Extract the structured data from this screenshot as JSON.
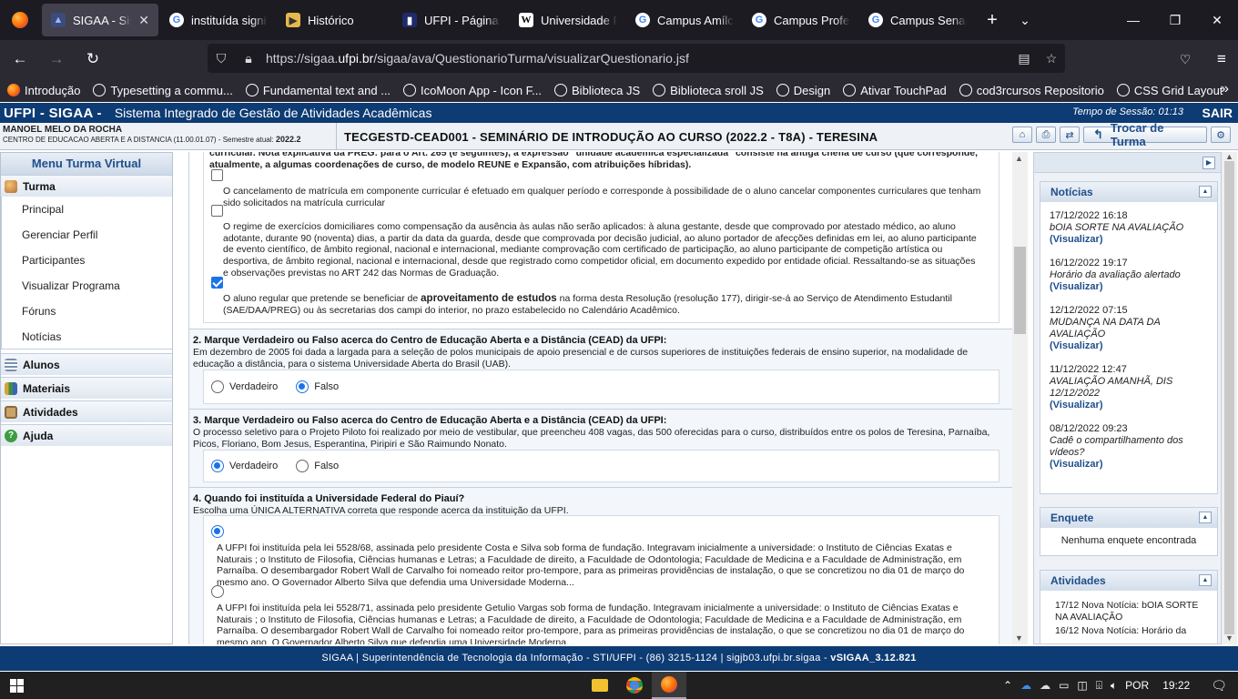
{
  "browser": {
    "tabs": [
      {
        "title": "SIGAA - Sistem",
        "active": true,
        "icon": "sigaa-favicon"
      },
      {
        "title": "instituída signific",
        "active": false,
        "icon": "google-favicon"
      },
      {
        "title": "Histórico",
        "active": false,
        "icon": "pdf-favicon"
      },
      {
        "title": "UFPI - Página inic",
        "active": false,
        "icon": "ufpi-favicon"
      },
      {
        "title": "Universidade Fed",
        "active": false,
        "icon": "wikipedia-favicon"
      },
      {
        "title": "Campus Amílcar",
        "active": false,
        "icon": "google-favicon"
      },
      {
        "title": "Campus Professo",
        "active": false,
        "icon": "google-favicon"
      },
      {
        "title": "Campus Senador",
        "active": false,
        "icon": "google-favicon"
      }
    ],
    "url_prefix": "https://sigaa.",
    "url_domain": "ufpi.br",
    "url_path": "/sigaa/ava/QuestionarioTurma/visualizarQuestionario.jsf",
    "bookmarks": [
      "Introdução",
      "Typesetting a commu...",
      "Fundamental text and ...",
      "IcoMoon App - Icon F...",
      "Biblioteca JS",
      "Biblioteca sroll JS",
      "Design",
      "Ativar TouchPad",
      "cod3rcursos Repositorio",
      "CSS Grid Layout"
    ]
  },
  "sigaa": {
    "brand": "UFPI - SIGAA -",
    "system": "Sistema Integrado de Gestão de Atividades Acadêmicas",
    "session_label": "Tempo de Sessão:",
    "session_time": "01:13",
    "logout": "SAIR",
    "user_name": "MANOEL MELO DA ROCHA",
    "user_center": "CENTRO DE EDUCACAO ABERTA E A DISTANCIA (11.00.01.07) - Semestre atual:",
    "semester": "2022.2",
    "class_title": "TECGESTD-CEAD001 - SEMINÁRIO DE INTRODUÇÃO AO CURSO (2022.2 - T8A) - TERESINA",
    "change_class": "Trocar de Turma"
  },
  "menu": {
    "header": "Menu Turma Virtual",
    "turma_label": "Turma",
    "turma_items": [
      "Principal",
      "Gerenciar Perfil",
      "Participantes",
      "Visualizar Programa",
      "Fóruns",
      "Notícias"
    ],
    "sections": [
      "Alunos",
      "Materiais",
      "Atividades",
      "Ajuda"
    ]
  },
  "q1": {
    "opt0": "curricular. Nota explicativa da PREG: para o Art. 265 (e seguintes), a expressão \"unidade acadêmica especializada\" consiste na antiga chefia de curso (que corresponde, atualmente, a algumas coordenações de curso, de modelo REUNE e Expansão, com atribuições híbridas).",
    "opt1": "O cancelamento de matrícula em componente curricular é efetuado em qualquer período e corresponde à possibilidade de o aluno cancelar componentes curriculares que tenham sido solicitados na matrícula curricular",
    "opt2": "O regime de exercícios domiciliares como compensação da ausência às aulas não serão aplicados: à aluna gestante, desde que comprovado por atestado médico, ao aluno adotante, durante 90 (noventa) dias, a partir da data da guarda, desde que comprovada por decisão judicial, ao aluno portador de afecções definidas em lei, ao aluno participante de evento científico, de âmbito regional, nacional e internacional, mediante comprovação com certificado de participação,  ao aluno participante de competição artística ou desportiva, de âmbito regional, nacional e internacional, desde que registrado como competidor oficial, em documento expedido por entidade oficial.  Ressaltando-se as situações e observações previstas no ART 242 das Normas de Graduação.",
    "opt3_a": "O aluno regular que pretende se beneficiar de ",
    "opt3_b": "aproveitamento de estudos",
    "opt3_c": " na forma desta Resolução (resolução 177), dirigir-se-á ao Serviço de Atendimento Estudantil (SAE/DAA/PREG) ou às secretarias dos campi do interior, no prazo estabelecido no Calendário Acadêmico.",
    "checked": [
      false,
      false,
      true
    ]
  },
  "q2": {
    "title": "2. Marque Verdadeiro ou Falso acerca do Centro de Educação Aberta e a Distância (CEAD) da UFPI:",
    "text": "Em dezembro de 2005 foi dada a largada para a seleção de polos municipais de apoio presencial e de cursos superiores de instituições federais de ensino superior, na modalidade de educação a distância, para o sistema Universidade Aberta do Brasil (UAB).",
    "true_label": "Verdadeiro",
    "false_label": "Falso",
    "selected": "Falso"
  },
  "q3": {
    "title": "3. Marque Verdadeiro ou Falso acerca do Centro de Educação Aberta e a Distância (CEAD) da UFPI:",
    "text": "O processo seletivo para o Projeto Piloto foi realizado por meio de vestibular, que preencheu 408 vagas, das 500 oferecidas para o curso, distribuídos entre os polos de Teresina, Parnaíba, Picos, Floriano, Bom Jesus, Esperantina, Piripiri e São Raimundo Nonato.",
    "true_label": "Verdadeiro",
    "false_label": "Falso",
    "selected": "Verdadeiro"
  },
  "q4": {
    "title": "4. Quando foi instituída a Universidade Federal do Piauí?",
    "text": "Escolha uma ÚNICA ALTERNATIVA correta que responde acerca da instituição da UFPI.",
    "opt1": "A UFPI foi instituída pela lei 5528/68, assinada pelo presidente Costa e Silva  sob forma de fundação. Integravam inicialmente a universidade:  o Instituto de Ciências Exatas e Naturais ; o Instituto de Filosofia, Ciências humanas e Letras; a Faculdade de direito, a Faculdade de Odontologia; Faculdade de Medicina e a Faculdade de Administração, em Parnaíba.  O desembargador Robert Wall de Carvalho foi nomeado reitor pro-tempore, para as primeiras providências de instalação, o que se concretizou no dia 01 de março do mesmo ano. O Governador Alberto Silva que defendia uma Universidade Moderna...",
    "opt2": "A UFPI foi instituída pela lei 5528/71, assinada pelo presidente Getulio Vargas  sob forma de fundação. Integravam inicialmente a universidade:  o Instituto de Ciências Exatas e Naturais ; o Instituto de Filosofia, Ciências humanas e Letras; a Faculdade de direito, a Faculdade de Odontologia; Faculdade de Medicina e a Faculdade de Administração, em Parnaíba.  O desembargador Robert Wall de Carvalho foi nomeado reitor pro-tempore, para as primeiras providências de instalação, o que se concretizou no dia 01 de março do mesmo ano. O Governador Alberto Silva que defendia uma Universidade Moderna...",
    "selected": 1
  },
  "noticias": {
    "header": "Notícias",
    "items": [
      {
        "date": "17/12/2022 16:18",
        "title": "bOIA SORTE NA AVALIAÇÃO",
        "link": "(Visualizar)"
      },
      {
        "date": "16/12/2022 19:17",
        "title": "Horário da avaliação alertado",
        "link": "(Visualizar)"
      },
      {
        "date": "12/12/2022 07:15",
        "title": "MUDANÇA NA DATA DA AVALIAÇÃO",
        "link": "(Visualizar)"
      },
      {
        "date": "11/12/2022 12:47",
        "title": "AVALIAÇÃO AMANHÃ, DIS 12/12/2022",
        "link": "(Visualizar)"
      },
      {
        "date": "08/12/2022 09:23",
        "title": "Cadê o compartilhamento dos vídeos?",
        "link": "(Visualizar)"
      }
    ]
  },
  "enquete": {
    "header": "Enquete",
    "empty": "Nenhuma enquete encontrada"
  },
  "atividades": {
    "header": "Atividades",
    "items": [
      "17/12 Nova Notícia: bOIA SORTE NA AVALIAÇÃO",
      "16/12 Nova Notícia: Horário da"
    ]
  },
  "footer": {
    "text": "SIGAA | Superintendência de Tecnologia da Informação - STI/UFPI - (86) 3215-1124 | sigjb03.ufpi.br.sigaa - ",
    "version": "vSIGAA_3.12.821"
  },
  "taskbar": {
    "lang": "POR",
    "time": "19:22"
  },
  "colors": {
    "sigaa_blue": "#0d3b73",
    "link_blue": "#1f4e8c",
    "radio_blue": "#1a73e8"
  }
}
